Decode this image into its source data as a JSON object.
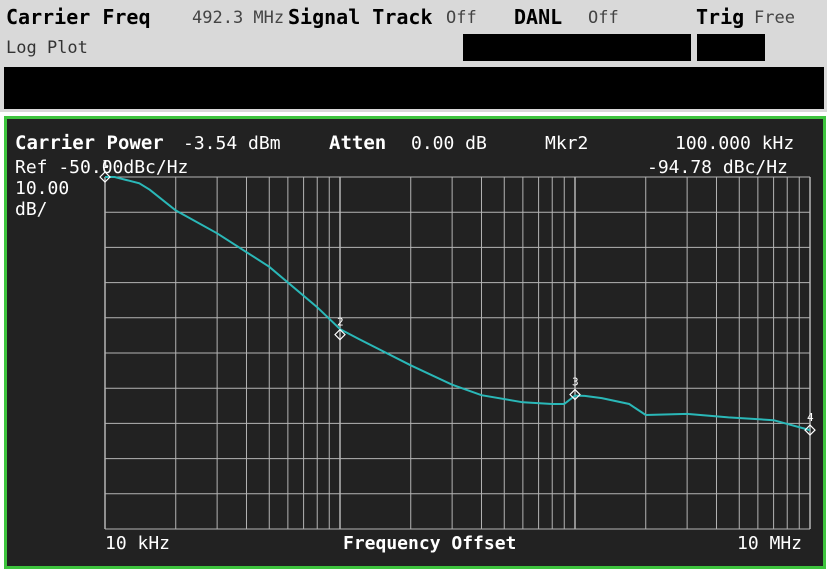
{
  "status_bar": {
    "carrier_freq_label": "Carrier Freq",
    "carrier_freq_value": "492.3 MHz",
    "signal_track_label": "Signal Track",
    "signal_track_value": "Off",
    "danl_label": "DANL",
    "danl_value": "Off",
    "trig_label": "Trig",
    "trig_value": "Free",
    "view_label": "Log Plot"
  },
  "plot_header": {
    "carrier_power_label": "Carrier Power",
    "carrier_power_value": "-3.54 dBm",
    "atten_label": "Atten",
    "atten_value": "0.00 dB",
    "marker_label": "Mkr2",
    "marker_freq": "100.000 kHz",
    "ref_label": "Ref -50.00dBc/Hz",
    "marker_value": "-94.78 dBc/Hz",
    "scale_value": "10.00",
    "scale_unit": "dB/"
  },
  "plot_footer": {
    "start_label": "10 kHz",
    "axis_label": "Frequency Offset",
    "stop_label": "10 MHz"
  },
  "colors": {
    "trace": "#2ab8b8",
    "frame_border": "#3ec43e",
    "plot_bg": "#222222",
    "grid": "#b4b4b4"
  },
  "chart_data": {
    "type": "line",
    "xscale": "log",
    "xlim": [
      10000,
      10000000
    ],
    "ylim": [
      -150,
      -50
    ],
    "ylabel_ref": "Ref -50.00dBc/Hz",
    "scale_per_div": "10.00 dB/",
    "xlabel": "Frequency Offset",
    "tick_labels": [
      "10 kHz",
      "10 MHz"
    ],
    "series": [
      {
        "x": [
          10000,
          11000,
          14000,
          15500,
          20000,
          30000,
          50000,
          80000,
          100000,
          120000,
          200000,
          300000,
          400000,
          600000,
          800000,
          900000,
          1000000,
          1100000,
          1300000,
          1700000,
          2000000,
          3000000,
          4500000,
          7000000,
          10000000
        ],
        "y": [
          -50,
          -50,
          -51.8,
          -53.6,
          -59.5,
          -66,
          -75.5,
          -87,
          -93.2,
          -96,
          -103.5,
          -109,
          -112,
          -114,
          -114.5,
          -114.5,
          -112.1,
          -112.2,
          -112.8,
          -114.5,
          -117.6,
          -117.3,
          -118.3,
          -119.1,
          -121.9
        ]
      }
    ],
    "markers": [
      {
        "label": "1",
        "x": 10000,
        "y": -50
      },
      {
        "label": "2",
        "x": 100000,
        "y": -94.78
      },
      {
        "label": "3",
        "x": 1000000,
        "y": -111.8
      },
      {
        "label": "4",
        "x": 10000000,
        "y": -121.9
      }
    ]
  }
}
